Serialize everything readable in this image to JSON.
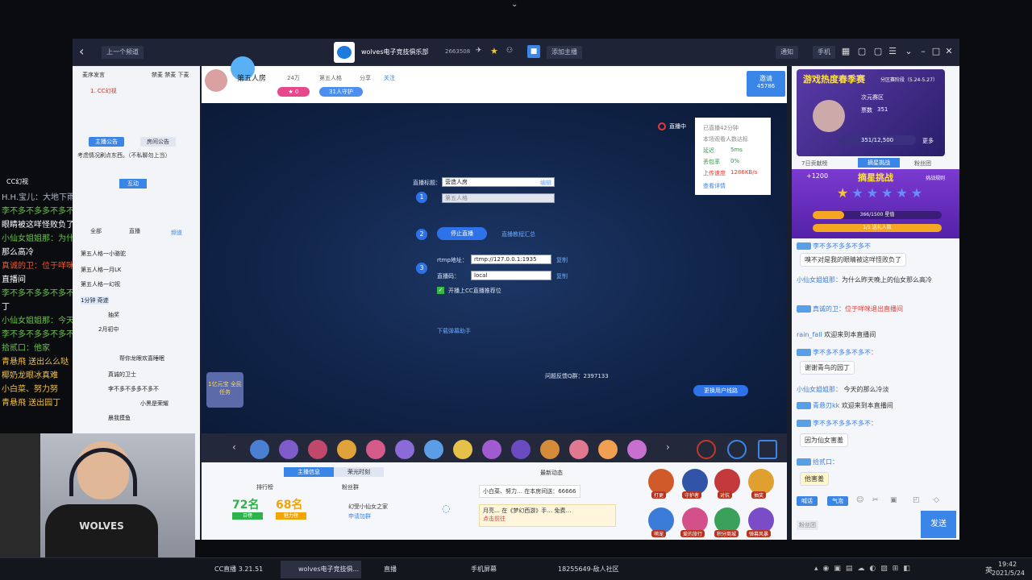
{
  "window": {
    "back_label": "‹",
    "prev_channel": "上一个频道",
    "room_name": "wolves电子竞技俱乐部",
    "room_id": "2663508",
    "add_anchor": "添加主播",
    "notify": "通知",
    "phone": "手机"
  },
  "left_panel": {
    "tabs": [
      "麦序发言",
      "禁麦 禁麦 下麦"
    ],
    "host": "1. CC幻视",
    "notice_tab1": "主播公告",
    "notice_tab2": "房间公告",
    "notice_text": "考虑情况刷点东西。（不私聊勿上当）",
    "interact": "互动",
    "list_tabs": [
      "全部",
      "直播",
      "频道"
    ],
    "list": [
      "第五人格一小骆驼",
      "第五人格一月LK",
      "第五人格一幻视",
      "1分钟 奇迹",
      "抽奖",
      "2月初中",
      "帮你龙眼欢喜睡眠",
      "真诚的卫士",
      "李不多不多多不多不",
      "小黑是荣耀",
      "晨我摸鱼"
    ]
  },
  "overlay_chat": {
    "title": "CC幻视",
    "messages": [
      {
        "text": "H.H.宝儿：大地下雨更远",
        "color": "#b0b8c8"
      },
      {
        "text": "李不多不多多不多不",
        "color": "#6cc24a"
      },
      {
        "text": "眼睛被这咩怪败负了",
        "color": "#ffffff"
      },
      {
        "text": "小仙女姐姐那：为什么昨天晚上的仙女",
        "color": "#6cc24a"
      },
      {
        "text": "那么高冷",
        "color": "#ffffff"
      },
      {
        "text": "真诚的卫：位于咩咪退出直播间",
        "color": "#e85a3a"
      },
      {
        "text": "直播间",
        "color": "#ffffff"
      },
      {
        "text": "李不多不多多不多不",
        "color": "#6cc24a"
      },
      {
        "text": "丁",
        "color": "#ffffff"
      },
      {
        "text": "小仙女姐姐那：今天的那么冷淡",
        "color": "#6cc24a"
      },
      {
        "text": "李不多不多多不多不：小白菜",
        "color": "#6cc24a"
      },
      {
        "text": "拾贰口：他家",
        "color": "#6cc24a"
      },
      {
        "text": "青悬飛 送出么么哒",
        "color": "#f0c040"
      },
      {
        "text": "椰奶龙眼冰真难",
        "color": "#f0c040"
      },
      {
        "text": "小白菜、努力努",
        "color": "#f0c040"
      },
      {
        "text": "青悬飛 送出园丁",
        "color": "#f0c040"
      }
    ]
  },
  "room_header": {
    "title": "第五人房",
    "fans": "24万",
    "category": "第五人格",
    "share": "分享",
    "follow": "关注",
    "guard_count": "31人守护",
    "rank": "0",
    "invite": "邀请",
    "invite_count": "45786"
  },
  "stage": {
    "live_status": "直播中",
    "stats": {
      "duration": "已直播42分钟",
      "rank_text": "本场观看人数达标",
      "delay_label": "延迟",
      "delay_value": "5ms",
      "loss_label": "丢包率",
      "loss_value": "0%",
      "upload_label": "上传速度",
      "upload_value": "1286KB/s",
      "detail": "查看详情"
    },
    "live_title_label": "直播标题：",
    "live_title_value": "营造人房",
    "category_value": "第五人格",
    "edit": "编辑",
    "stop_button": "停止直播",
    "settings_link": "直播教程汇总",
    "rtmp_label": "rtmp地址：",
    "rtmp_value": "rtmp://127.0.0.1:1935",
    "key_label": "直播码：",
    "key_value": "local",
    "copy": "复制",
    "checkbox_label": "开播上CC直播推荐位",
    "download": "下载弹幕助手",
    "feedback": "问题反馈Q群：2397133",
    "switch_line": "更换用户线路",
    "task_badge": "1亿元宝 全民任务"
  },
  "bottom": {
    "tab1": "主播信息",
    "tab2": "荣光时刻",
    "tab_news": "最新动态",
    "rank_label": "排行榜",
    "fans_label": "粉丝群",
    "score1": "72名",
    "score1_sub": "日榜",
    "score2": "68名",
    "score2_sub": "魅力榜",
    "fans_group": "幻受小仙女之家",
    "fans_link": "申请加群",
    "news1": "小白菜、努力… 在本房间送：66666",
    "news2": "月亮… 在《梦幻西游》手… 免费…",
    "news_more": "点击前往",
    "circles": [
      "打更",
      "守护者",
      "对抗",
      "抽奖",
      "萌宠",
      "爱的旅行",
      "积分商城",
      "弹幕风暴"
    ]
  },
  "right_panel": {
    "banner_title": "游戏热度春季赛",
    "banner_sub": "次元赛区",
    "banner_date": "分区赛阶段（5.24-5.27）",
    "score_label": "票数",
    "score_value": "351",
    "progress_text": "351/12,500",
    "more": "更多",
    "tabs": [
      "7日贡献榜",
      "摘星挑战",
      "粉丝团"
    ],
    "challenge_title": "摘星挑战",
    "challenge_rule": "挑战规则",
    "challenge_bonus": "+1200",
    "bar1": "366/1500 星值",
    "bar2": "1/1 送礼人数",
    "chat": [
      {
        "nick": "李不多不多多不多不",
        "text": ""
      },
      {
        "nick": "",
        "text": "嗅不对是我的眼睛被这咩怪败负了"
      },
      {
        "nick": "小仙女姐姐那：",
        "text": "为什么昨天晚上的仙女那么高冷"
      },
      {
        "nick": "真诚的卫：",
        "text": "位于咩咪退出直播间"
      },
      {
        "nick": "rain_fall",
        "text": "欢迎来到本直播间"
      },
      {
        "nick": "李不多不多多不多不：",
        "text": ""
      },
      {
        "nick": "",
        "text": "谢谢青鸟的园丁"
      },
      {
        "nick": "小仙女姐姐那：",
        "text": "今天的那么冷淡"
      },
      {
        "nick": "青悬刃kk",
        "text": "欢迎来到本直播间"
      },
      {
        "nick": "李不多不多多不多不：",
        "text": ""
      },
      {
        "nick": "",
        "text": "因为仙女害羞"
      },
      {
        "nick": "拾贰口：",
        "text": ""
      },
      {
        "nick": "",
        "text": "他害羞"
      }
    ],
    "input_tabs": [
      "喊话",
      "气泡"
    ],
    "fans_btn": "粉丝团",
    "send": "发送"
  },
  "taskbar": {
    "items": [
      "CC直播 3.21.51",
      "wolves电子竞技俱...",
      "直播",
      "手机屏幕",
      "18255649-敌人社区"
    ],
    "time": "19:42",
    "date": "2021/5/24",
    "lang": "英"
  },
  "colors": {
    "accent": "#2d72e8",
    "stage_bg": "#102347",
    "send": "#3a86e8"
  }
}
